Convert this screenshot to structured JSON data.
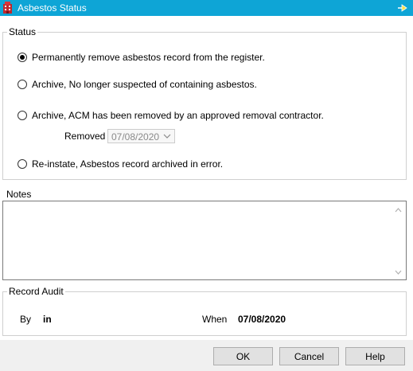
{
  "window": {
    "title": "Asbestos Status"
  },
  "status": {
    "legend": "Status",
    "options": [
      {
        "label": "Permanently remove asbestos record from the register.",
        "checked": true
      },
      {
        "label": "Archive, No longer suspected of containing asbestos.",
        "checked": false
      },
      {
        "label": "Archive, ACM has been removed by an approved removal contractor.",
        "checked": false
      },
      {
        "label": "Re-instate, Asbestos record archived in error.",
        "checked": false
      }
    ],
    "removed_label": "Removed",
    "removed_date": "07/08/2020"
  },
  "notes": {
    "label": "Notes",
    "value": ""
  },
  "audit": {
    "legend": "Record Audit",
    "by_label": "By",
    "by_value": "in",
    "when_label": "When",
    "when_value": "07/08/2020"
  },
  "buttons": {
    "ok": "OK",
    "cancel": "Cancel",
    "help": "Help"
  },
  "icons": {
    "app": "building-icon",
    "pin": "pin-icon"
  },
  "colors": {
    "titlebar": "#0ea5d6",
    "title_text": "#ffffff"
  }
}
